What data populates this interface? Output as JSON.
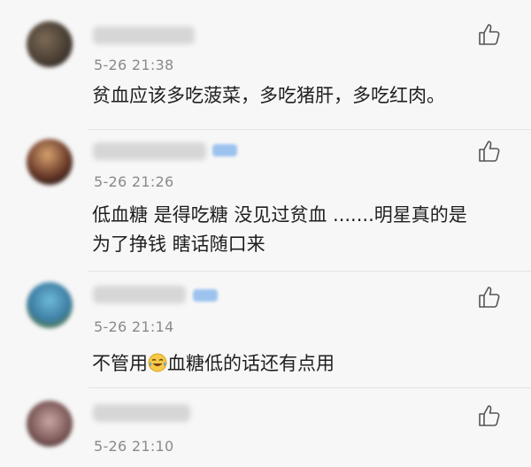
{
  "comments": [
    {
      "time": "5-26 21:38",
      "text": "贫血应该多吃菠菜，多吃猪肝，多吃红肉。",
      "text_line2": ""
    },
    {
      "time": "5-26 21:26",
      "text": "低血糖 是得吃糖 没见过贫血 .......明星真的是",
      "text_line2": "为了挣钱 瞎话随口来"
    },
    {
      "time": "5-26 21:14",
      "text_before_emoji": "不管用",
      "text_after_emoji": "血糖低的话还有点用"
    },
    {
      "time": "5-26 21:10"
    }
  ],
  "icons": {
    "like": "thumbs-up-icon",
    "emoji": "laughing-crying-emoji-icon"
  },
  "colors": {
    "background": "#f7f7f7",
    "text": "#1f1f1f",
    "time": "#8a8a8a",
    "vip": "#9cc3ee"
  }
}
